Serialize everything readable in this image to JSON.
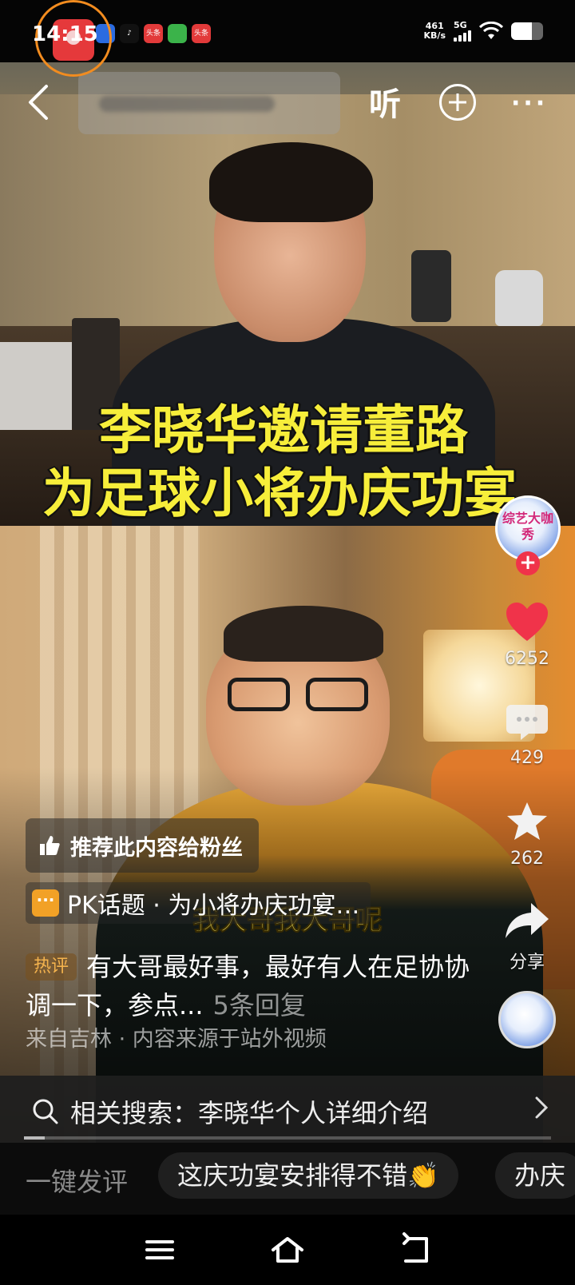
{
  "status_bar": {
    "time": "14:15",
    "app_icons": [
      {
        "name": "app-icon",
        "label": "",
        "color": "#2b6be0"
      },
      {
        "name": "tiktok-icon",
        "label": "♪",
        "color": "#111111"
      },
      {
        "name": "toutiao-icon",
        "label": "头条",
        "color": "#e23a3a"
      },
      {
        "name": "app-green-icon",
        "label": "",
        "color": "#3bb34a"
      },
      {
        "name": "toutiao-icon",
        "label": "头条",
        "color": "#e23a3a"
      }
    ],
    "net_speed_value": "461",
    "net_speed_unit": "KB/s",
    "network": "5G",
    "battery_level": 0.65
  },
  "top_bar": {
    "listen_label": "听"
  },
  "video": {
    "title_line1": "李晓华邀请董路",
    "title_line2": "为足球小将办庆功宴",
    "subtitle": "我大哥我大哥呢"
  },
  "author": {
    "avatar_text": "综艺大咖秀",
    "follow_label": "+"
  },
  "actions": {
    "like_count": "6252",
    "comment_count": "429",
    "favorite_count": "262",
    "share_label": "分享"
  },
  "recommend_chip": {
    "label": "推荐此内容给粉丝"
  },
  "pk_topic": {
    "label": "PK话题 · 为小将办庆功宴…"
  },
  "hot_comment": {
    "tag": "热评",
    "text": "有大哥最好事，最好有人在足协协调一下，参点...",
    "reply_count": "5条回复"
  },
  "source_line": "来自吉林 · 内容来源于站外视频",
  "related_search": {
    "label": "相关搜索：李晓华个人详细介绍"
  },
  "progress": 0.04,
  "quick_comment": {
    "label": "一键发评",
    "chips": [
      "这庆功宴安排得不错👏",
      "办庆"
    ]
  },
  "colors": {
    "accent_red": "#f0334a",
    "title_yellow": "#f7ee3a",
    "hot_tag": "#f4b34e"
  }
}
